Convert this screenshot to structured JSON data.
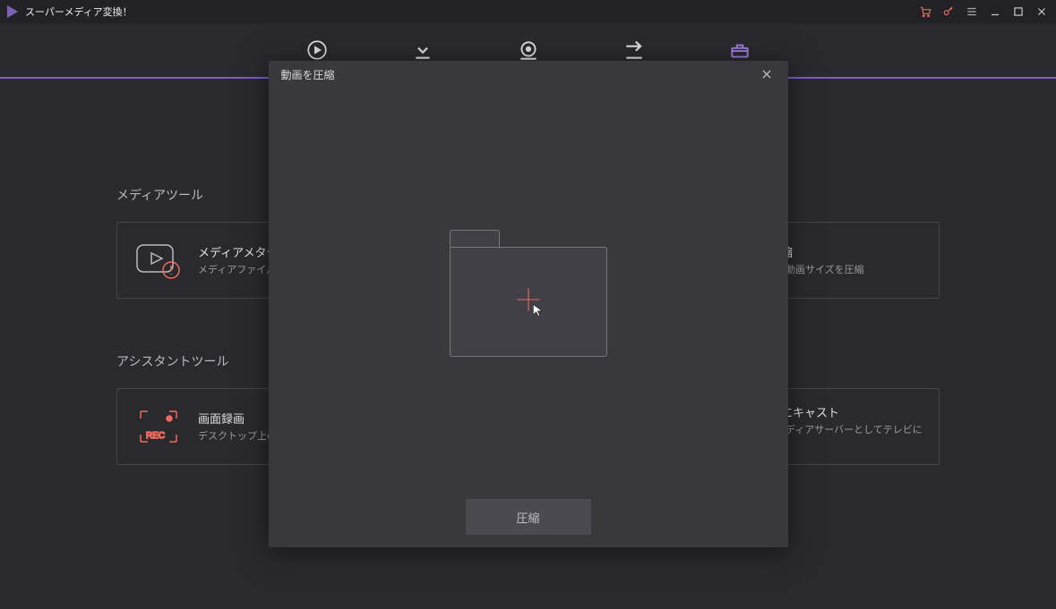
{
  "app": {
    "title": "スーパーメディア変換！"
  },
  "sections": {
    "media_tools": "メディアツール",
    "assistant_tools": "アシスタントツール"
  },
  "cards": {
    "metadata": {
      "title": "メディアメタデータ",
      "desc": "メディアファイルの修正と編集"
    },
    "compress": {
      "title": "動画圧縮",
      "desc": "無劣化で動画サイズを圧縮"
    },
    "record": {
      "title": "画面録画",
      "desc": "デスクトップ上のすべて録画できる"
    },
    "cast": {
      "title": "テレビにキャスト",
      "desc": "動画をメディアサーバーとしてテレビにキャスト"
    },
    "rec_label": "REC"
  },
  "modal": {
    "title": "動画を圧縮",
    "button": "圧縮"
  }
}
